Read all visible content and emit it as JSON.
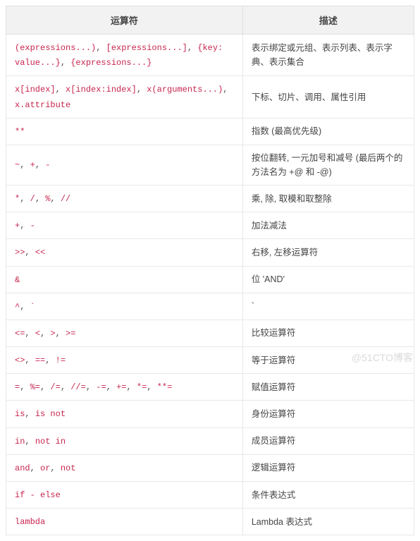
{
  "headers": {
    "operator": "运算符",
    "description": "描述"
  },
  "rows": [
    {
      "operators": [
        "(expressions...)",
        "[expressions...]",
        "{key: value...}",
        "{expressions...}"
      ],
      "description": "表示绑定或元组、表示列表、表示字典、表示集合"
    },
    {
      "operators": [
        "x[index]",
        "x[index:index]",
        "x(arguments...)",
        "x.attribute"
      ],
      "description": "下标、切片、调用、属性引用"
    },
    {
      "operators": [
        "**"
      ],
      "description": "指数 (最高优先级)"
    },
    {
      "operators": [
        "~",
        "+",
        "-"
      ],
      "description": "按位翻转, 一元加号和减号 (最后两个的方法名为 +@ 和 -@)"
    },
    {
      "operators": [
        "*",
        "/",
        "%",
        "//"
      ],
      "description": "乘, 除, 取模和取整除"
    },
    {
      "operators": [
        "+",
        "-"
      ],
      "description": "加法减法"
    },
    {
      "operators": [
        ">>",
        "<<"
      ],
      "description": "右移, 左移运算符"
    },
    {
      "operators": [
        "&"
      ],
      "description": "位 'AND'"
    },
    {
      "operators": [
        "^",
        "`"
      ],
      "description": "`"
    },
    {
      "operators": [
        "<=",
        "<",
        ">",
        ">="
      ],
      "description": "比较运算符"
    },
    {
      "operators": [
        "<>",
        "==",
        "!="
      ],
      "description": "等于运算符"
    },
    {
      "operators": [
        "=",
        "%=",
        "/=",
        "//=",
        "-=",
        "+=",
        "*=",
        "**="
      ],
      "description": "赋值运算符"
    },
    {
      "operators": [
        "is",
        "is not"
      ],
      "description": "身份运算符"
    },
    {
      "operators": [
        "in",
        "not in"
      ],
      "description": "成员运算符"
    },
    {
      "operators": [
        "and",
        "or",
        "not"
      ],
      "description": "逻辑运算符"
    },
    {
      "operators": [
        "if - else"
      ],
      "description": "条件表达式"
    },
    {
      "operators": [
        "lambda"
      ],
      "description": "Lambda 表达式"
    }
  ],
  "watermark": "@51CTO博客"
}
